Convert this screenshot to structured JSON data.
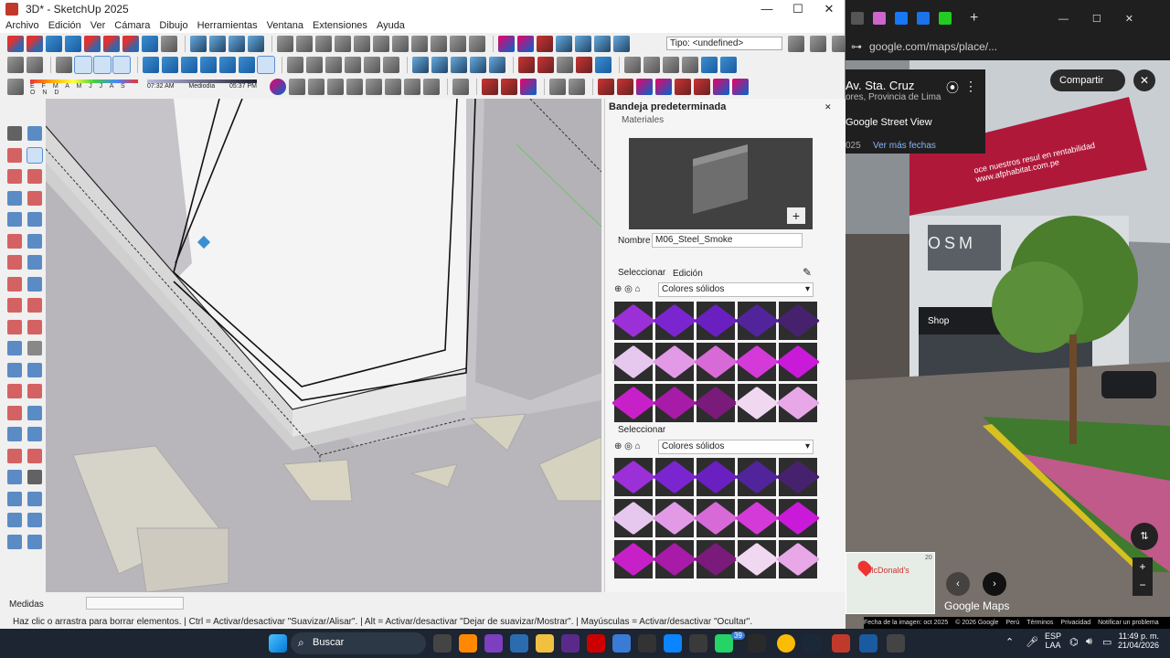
{
  "sketchup": {
    "title": "3D* - SketchUp 2025",
    "menu": [
      "Archivo",
      "Edición",
      "Ver",
      "Cámara",
      "Dibujo",
      "Herramientas",
      "Ventana",
      "Extensiones",
      "Ayuda"
    ],
    "tipo_field": "Tipo: <undefined>",
    "shadow_months": "E F M A M J J A S O N D",
    "time_start": "07:32 AM",
    "time_mid": "Mediodía",
    "time_end": "05:37 PM",
    "tray": {
      "title": "Bandeja predeterminada",
      "section": "Materiales",
      "name_label": "Nombre",
      "name_value": "M06_Steel_Smoke",
      "tab_select": "Seleccionar",
      "tab_edit": "Edición",
      "collection": "Colores sólidos",
      "second_tab": "Seleccionar",
      "second_collection": "Colores sólidos"
    },
    "measure_label": "Medidas",
    "status_text": "Haz clic o arrastra para borrar elementos. | Ctrl = Activar/desactivar \"Suavizar/Alisar\". | Alt = Activar/desactivar \"Dejar de suavizar/Mostrar\". | Mayúsculas = Activar/desactivar \"Ocultar\".",
    "swatch_colors": [
      "#9b2fd8",
      "#7b25d0",
      "#6a1fc0",
      "#52249c",
      "#46226e",
      "#e6c8ee",
      "#e29ae6",
      "#d86ad8",
      "#d33ad8",
      "#c81ad8",
      "#c820c8",
      "#a81aa8",
      "#7a1a7a",
      "#f0d8f0",
      "#e8a8e8"
    ]
  },
  "chrome": {
    "url": "google.com/maps/place/...",
    "place_title": "Av. Sta. Cruz",
    "place_sub": "ores, Provincia de Lima",
    "street_view": "Google Street View",
    "year": "025",
    "ver_mas": "Ver más fechas",
    "share": "Compartir",
    "billboard": "oce nuestros resul en rentabilidad www.afphabitat.com.pe",
    "store_sign": "OSM",
    "shop_sign": "Shop",
    "mini_label": "McDonald's",
    "mini_num": "20",
    "brand": "Google Maps",
    "footer": [
      "Fecha de la imagen: oct 2025",
      "© 2026 Google",
      "Perú",
      "Términos",
      "Privacidad",
      "Notificar un problema"
    ]
  },
  "taskbar": {
    "search": "Buscar",
    "lang": "ESP",
    "lang2": "LAA",
    "time": "11:49 p. m.",
    "date": "21/04/2026",
    "badge": "39"
  }
}
